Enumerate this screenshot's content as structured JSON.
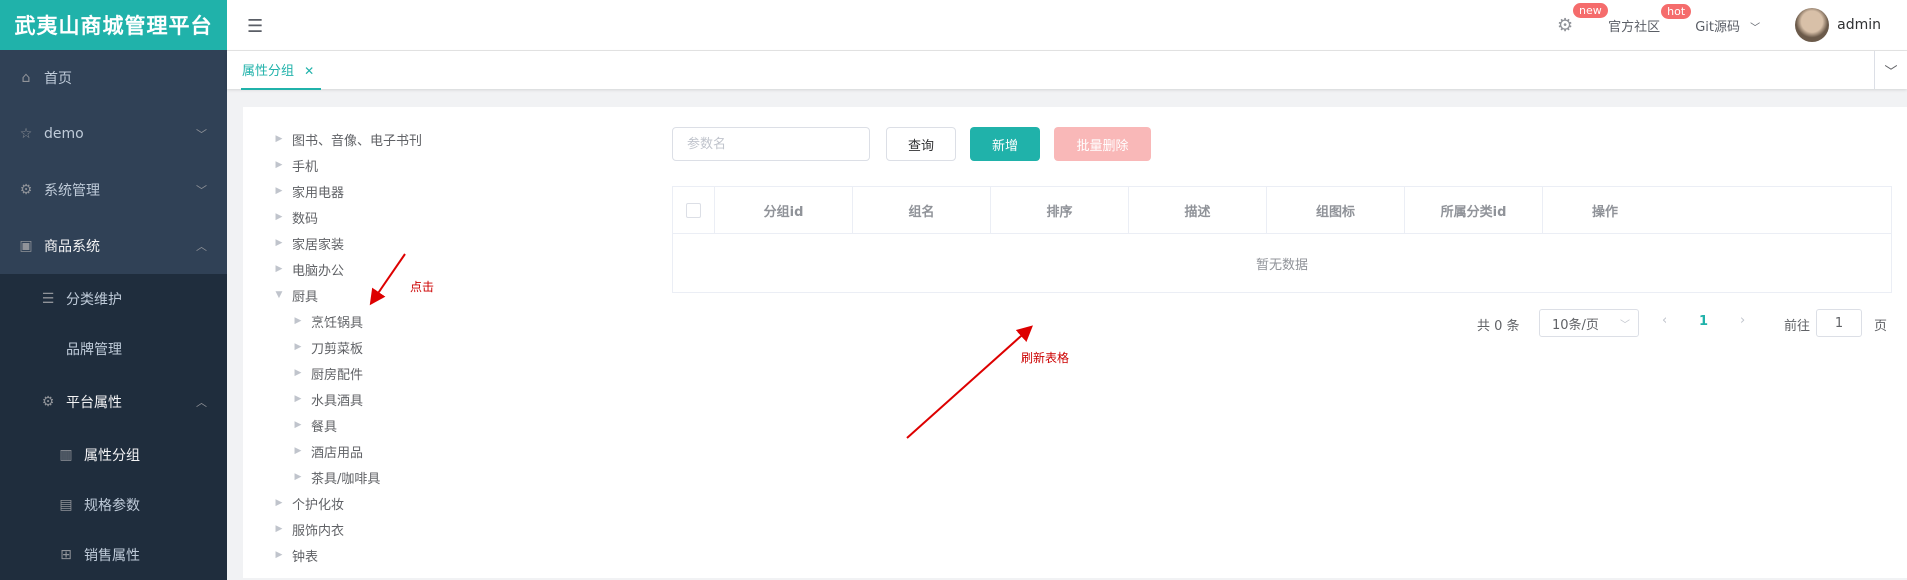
{
  "app": {
    "title": "武夷山商城管理平台"
  },
  "sidebar": {
    "items": [
      {
        "label": "首页"
      },
      {
        "label": "demo"
      },
      {
        "label": "系统管理"
      },
      {
        "label": "商品系统"
      },
      {
        "label": "分类维护"
      },
      {
        "label": "品牌管理"
      },
      {
        "label": "平台属性"
      },
      {
        "label": "属性分组"
      },
      {
        "label": "规格参数"
      },
      {
        "label": "销售属性"
      }
    ]
  },
  "header": {
    "badge_new": "new",
    "community": "官方社区",
    "badge_hot": "hot",
    "git": "Git源码",
    "user": "admin"
  },
  "tags": {
    "active": "属性分组"
  },
  "tree": {
    "nodes": [
      {
        "label": "图书、音像、电子书刊"
      },
      {
        "label": "手机"
      },
      {
        "label": "家用电器"
      },
      {
        "label": "数码"
      },
      {
        "label": "家居家装"
      },
      {
        "label": "电脑办公"
      },
      {
        "label": "厨具"
      },
      {
        "label": "烹饪锅具"
      },
      {
        "label": "刀剪菜板"
      },
      {
        "label": "厨房配件"
      },
      {
        "label": "水具酒具"
      },
      {
        "label": "餐具"
      },
      {
        "label": "酒店用品"
      },
      {
        "label": "茶具/咖啡具"
      },
      {
        "label": "个护化妆"
      },
      {
        "label": "服饰内衣"
      },
      {
        "label": "钟表"
      }
    ]
  },
  "toolbar": {
    "search_placeholder": "参数名",
    "query": "查询",
    "add": "新增",
    "batch_delete": "批量删除"
  },
  "table": {
    "columns": [
      "分组id",
      "组名",
      "排序",
      "描述",
      "组图标",
      "所属分类id",
      "操作"
    ],
    "empty_text": "暂无数据"
  },
  "pagination": {
    "total": "共 0 条",
    "page_size": "10条/页",
    "current_page": "1",
    "goto": "前往",
    "goto_value": "1",
    "page_suffix": "页"
  },
  "annotations": {
    "click": "点击",
    "refresh": "刷新表格"
  },
  "colors": {
    "brand": "#20b2aa",
    "sidebar": "#304156",
    "danger_light": "#f9b8b8",
    "annotation": "#cc0000"
  }
}
